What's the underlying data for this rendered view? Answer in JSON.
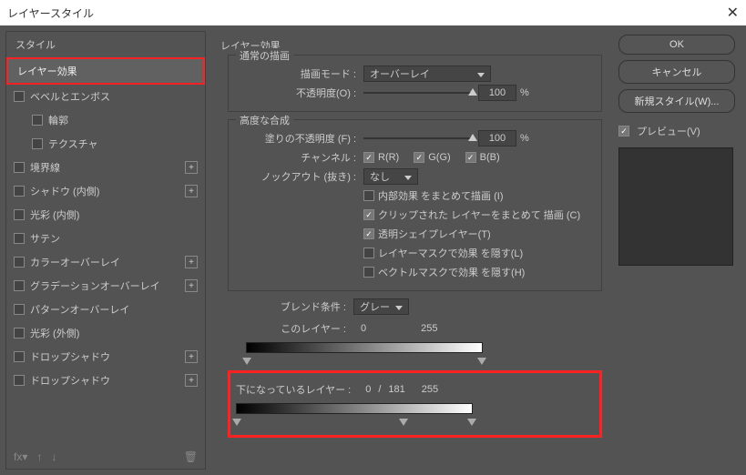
{
  "titlebar": {
    "title": "レイヤースタイル",
    "close": "✕"
  },
  "left": {
    "header": "スタイル",
    "selected": "レイヤー効果",
    "items": [
      {
        "label": "ベベルとエンボス",
        "indent": false,
        "plus": false
      },
      {
        "label": "輪郭",
        "indent": true,
        "plus": false
      },
      {
        "label": "テクスチャ",
        "indent": true,
        "plus": false
      },
      {
        "label": "境界線",
        "indent": false,
        "plus": true
      },
      {
        "label": "シャドウ (内側)",
        "indent": false,
        "plus": true
      },
      {
        "label": "光彩 (内側)",
        "indent": false,
        "plus": false
      },
      {
        "label": "サテン",
        "indent": false,
        "plus": false
      },
      {
        "label": "カラーオーバーレイ",
        "indent": false,
        "plus": true
      },
      {
        "label": "グラデーションオーバーレイ",
        "indent": false,
        "plus": true
      },
      {
        "label": "パターンオーバーレイ",
        "indent": false,
        "plus": false
      },
      {
        "label": "光彩 (外側)",
        "indent": false,
        "plus": false
      },
      {
        "label": "ドロップシャドウ",
        "indent": false,
        "plus": true
      },
      {
        "label": "ドロップシャドウ",
        "indent": false,
        "plus": true
      }
    ],
    "footer": {
      "fx": "fx"
    }
  },
  "mid": {
    "group1_title": "レイヤー効果",
    "sub1_title": "通常の描画",
    "blend_mode_label": "描画モード :",
    "blend_mode_value": "オーバーレイ",
    "opacity_label": "不透明度(O) :",
    "opacity_value": "100",
    "percent": "%",
    "sub2_title": "高度な合成",
    "fill_opacity_label": "塗りの不透明度 (F) :",
    "fill_opacity_value": "100",
    "channels_label": "チャンネル :",
    "ch_r": "R(R)",
    "ch_g": "G(G)",
    "ch_b": "B(B)",
    "knockout_label": "ノックアウト (抜き) :",
    "knockout_value": "なし",
    "adv": [
      {
        "label": "内部効果 をまとめて描画 (I)",
        "on": false
      },
      {
        "label": "クリップされた レイヤーをまとめて 描画 (C)",
        "on": true
      },
      {
        "label": "透明シェイプレイヤー(T)",
        "on": true
      },
      {
        "label": "レイヤーマスクで効果 を隠す(L)",
        "on": false
      },
      {
        "label": "ベクトルマスクで効果 を隠す(H)",
        "on": false
      }
    ],
    "blendif_label": "ブレンド条件 :",
    "blendif_value": "グレー",
    "this_layer_label": "このレイヤー :",
    "this_v0": "0",
    "this_v1": "255",
    "under_layer_label": "下になっているレイヤー :",
    "under_v0": "0",
    "under_slash": "/",
    "under_v1": "181",
    "under_v2": "255"
  },
  "right": {
    "ok": "OK",
    "cancel": "キャンセル",
    "newstyle": "新規スタイル(W)...",
    "preview": "プレビュー(V)"
  }
}
